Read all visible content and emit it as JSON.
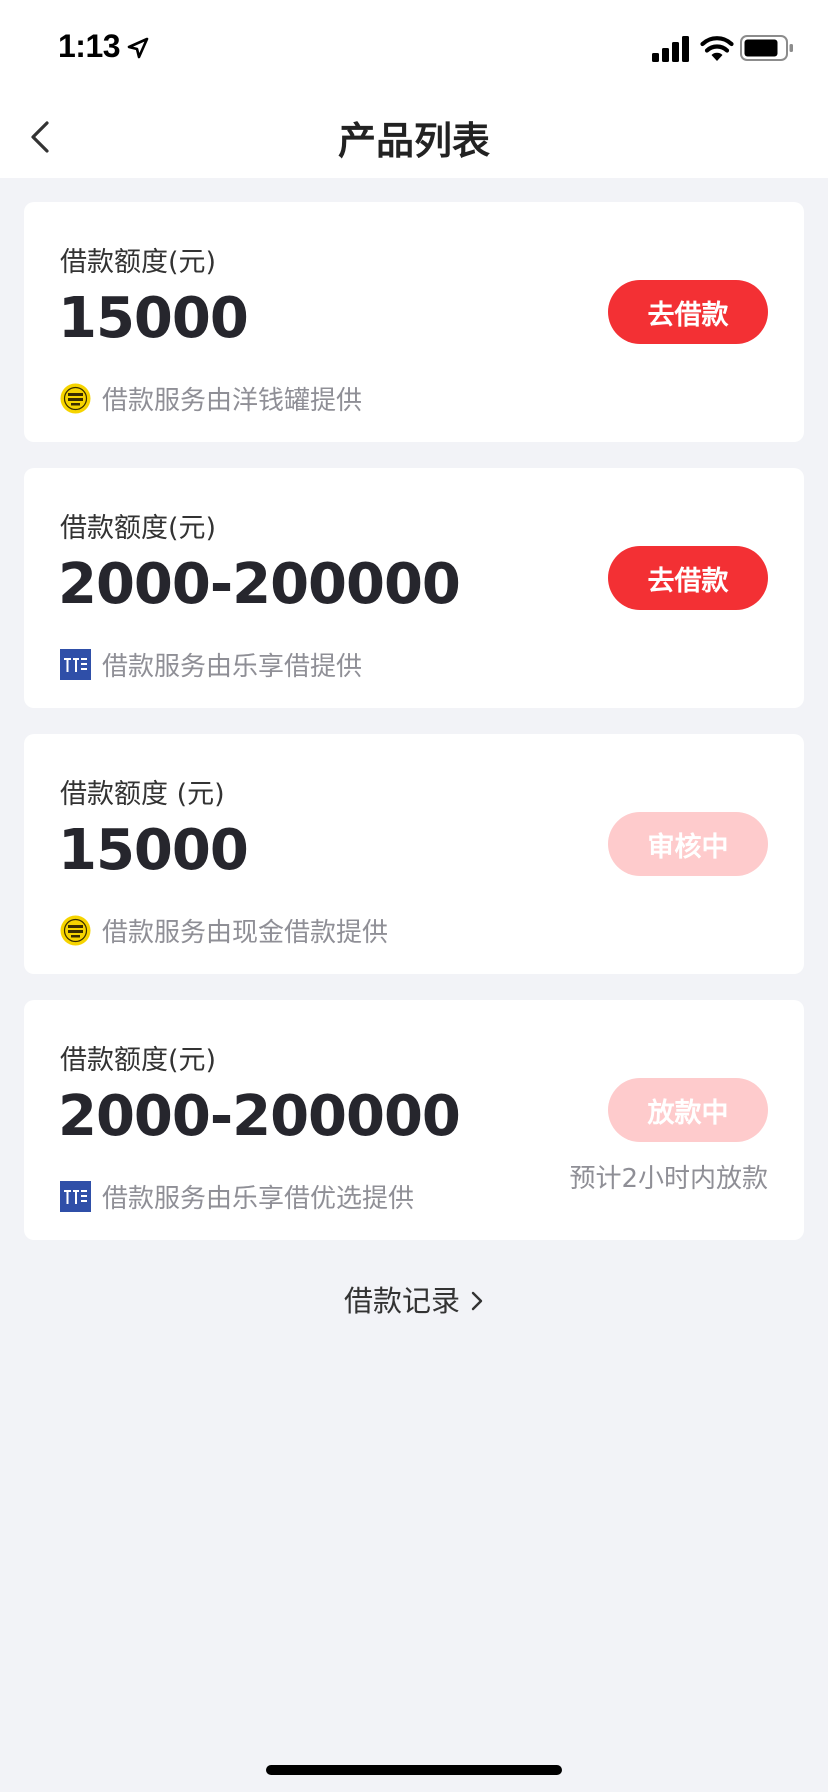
{
  "status_bar": {
    "time": "1:13"
  },
  "header": {
    "title": "产品列表"
  },
  "products": [
    {
      "label": "借款额度(元)",
      "amount": "15000",
      "provider_text": "借款服务由洋钱罐提供",
      "provider_logo": "coin-logo",
      "button_label": "去借款",
      "button_state": "active"
    },
    {
      "label": "借款额度(元)",
      "amount": "2000-200000",
      "provider_text": "借款服务由乐享借提供",
      "provider_logo": "lexiangjie-logo",
      "button_label": "去借款",
      "button_state": "active"
    },
    {
      "label": "借款额度 (元)",
      "amount": "15000",
      "provider_text": "借款服务由现金借款提供",
      "provider_logo": "coin-logo",
      "button_label": "审核中",
      "button_state": "disabled"
    },
    {
      "label": "借款额度(元)",
      "amount": "2000-200000",
      "provider_text": "借款服务由乐享借优选提供",
      "provider_logo": "lexiangjie-logo",
      "button_label": "放款中",
      "button_state": "disabled",
      "eta": "预计2小时内放款"
    }
  ],
  "footer": {
    "records_link": "借款记录"
  },
  "colors": {
    "primary": "#f33034",
    "disabled": "#fecbcc",
    "background": "#f2f3f7"
  }
}
